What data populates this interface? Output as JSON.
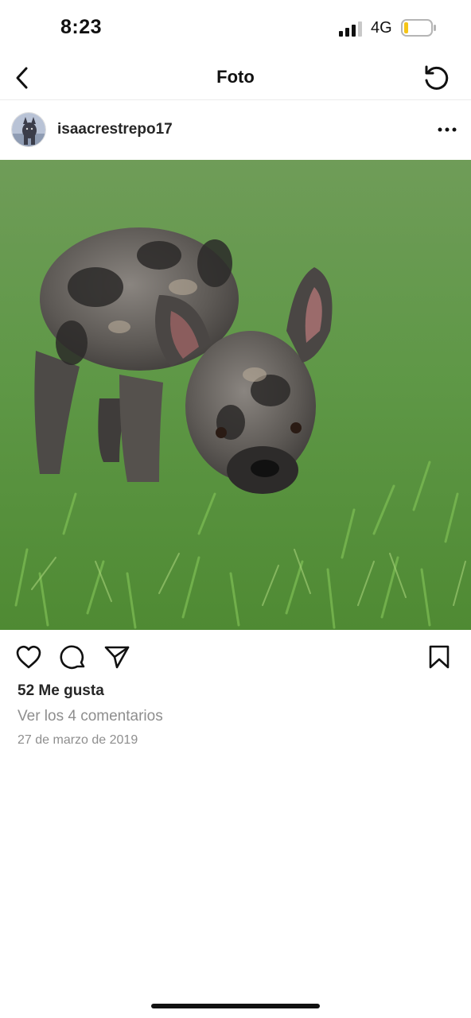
{
  "status_bar": {
    "time": "8:23",
    "network": "4G",
    "signal_bars": 3,
    "signal_bars_total": 4,
    "battery_level": 0.15,
    "battery_color": "#f5c518"
  },
  "nav": {
    "back_icon": "chevron-left-icon",
    "title": "Foto",
    "refresh_icon": "rotate-ccw-icon"
  },
  "post": {
    "username": "isaacrestrepo17",
    "more_icon": "more-horizontal-icon",
    "photo_alt": "Perro bulldog francés merle olfateando el césped"
  },
  "actions": {
    "like_icon": "heart-icon",
    "comment_icon": "comment-icon",
    "share_icon": "send-icon",
    "save_icon": "bookmark-icon"
  },
  "meta": {
    "likes": "52 Me gusta",
    "view_comments": "Ver los 4 comentarios",
    "date": "27 de marzo de 2019"
  },
  "colors": {
    "text_primary": "#262626",
    "text_secondary": "#8e8e8e",
    "divider": "#ececec"
  }
}
